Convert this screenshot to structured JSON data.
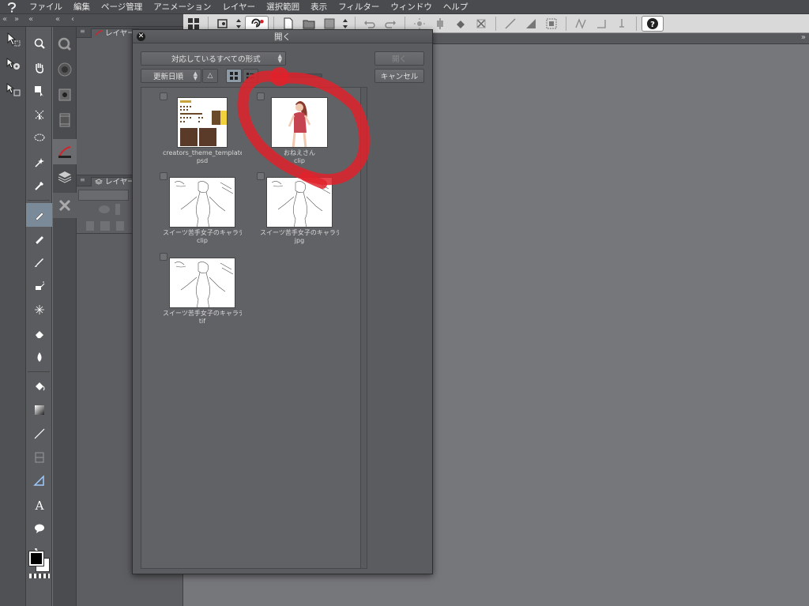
{
  "menu": {
    "items": [
      "ファイル",
      "編集",
      "ページ管理",
      "アニメーション",
      "レイヤー",
      "選択範囲",
      "表示",
      "フィルター",
      "ウィンドウ",
      "ヘルプ"
    ]
  },
  "command_bar": {
    "icons": [
      "grid-icon",
      "new-icon",
      "order-icon",
      "clip-studio-icon",
      "page-icon",
      "open-folder-icon",
      "save-icon",
      "undo-icon",
      "redo-icon",
      "transform-icon",
      "clear-icon",
      "fill-icon",
      "snap-icon",
      "ruler-icon",
      "help-icon"
    ]
  },
  "panels": {
    "layer_tab_1": "レイヤー",
    "layer_tab_2": "レイヤー"
  },
  "dialog": {
    "title": "開く",
    "file_type_filter": "対応しているすべての形式",
    "sort_by": "更新日順",
    "open_button": "開く",
    "cancel_button": "キャンセル",
    "files": [
      {
        "name": "creators_theme_template",
        "ext": "psd"
      },
      {
        "name": "おねえさん",
        "ext": "clip"
      },
      {
        "name": "スイーツ苦手女子のキャラデ",
        "ext": "clip"
      },
      {
        "name": "スイーツ苦手女子のキャラデ",
        "ext": "jpg"
      },
      {
        "name": "スイーツ苦手女子のキャラデ",
        "ext": "tif"
      }
    ]
  },
  "colors": {
    "annotation": "#e0222b",
    "main_color": "#000000",
    "sub_color": "#ffffff"
  }
}
